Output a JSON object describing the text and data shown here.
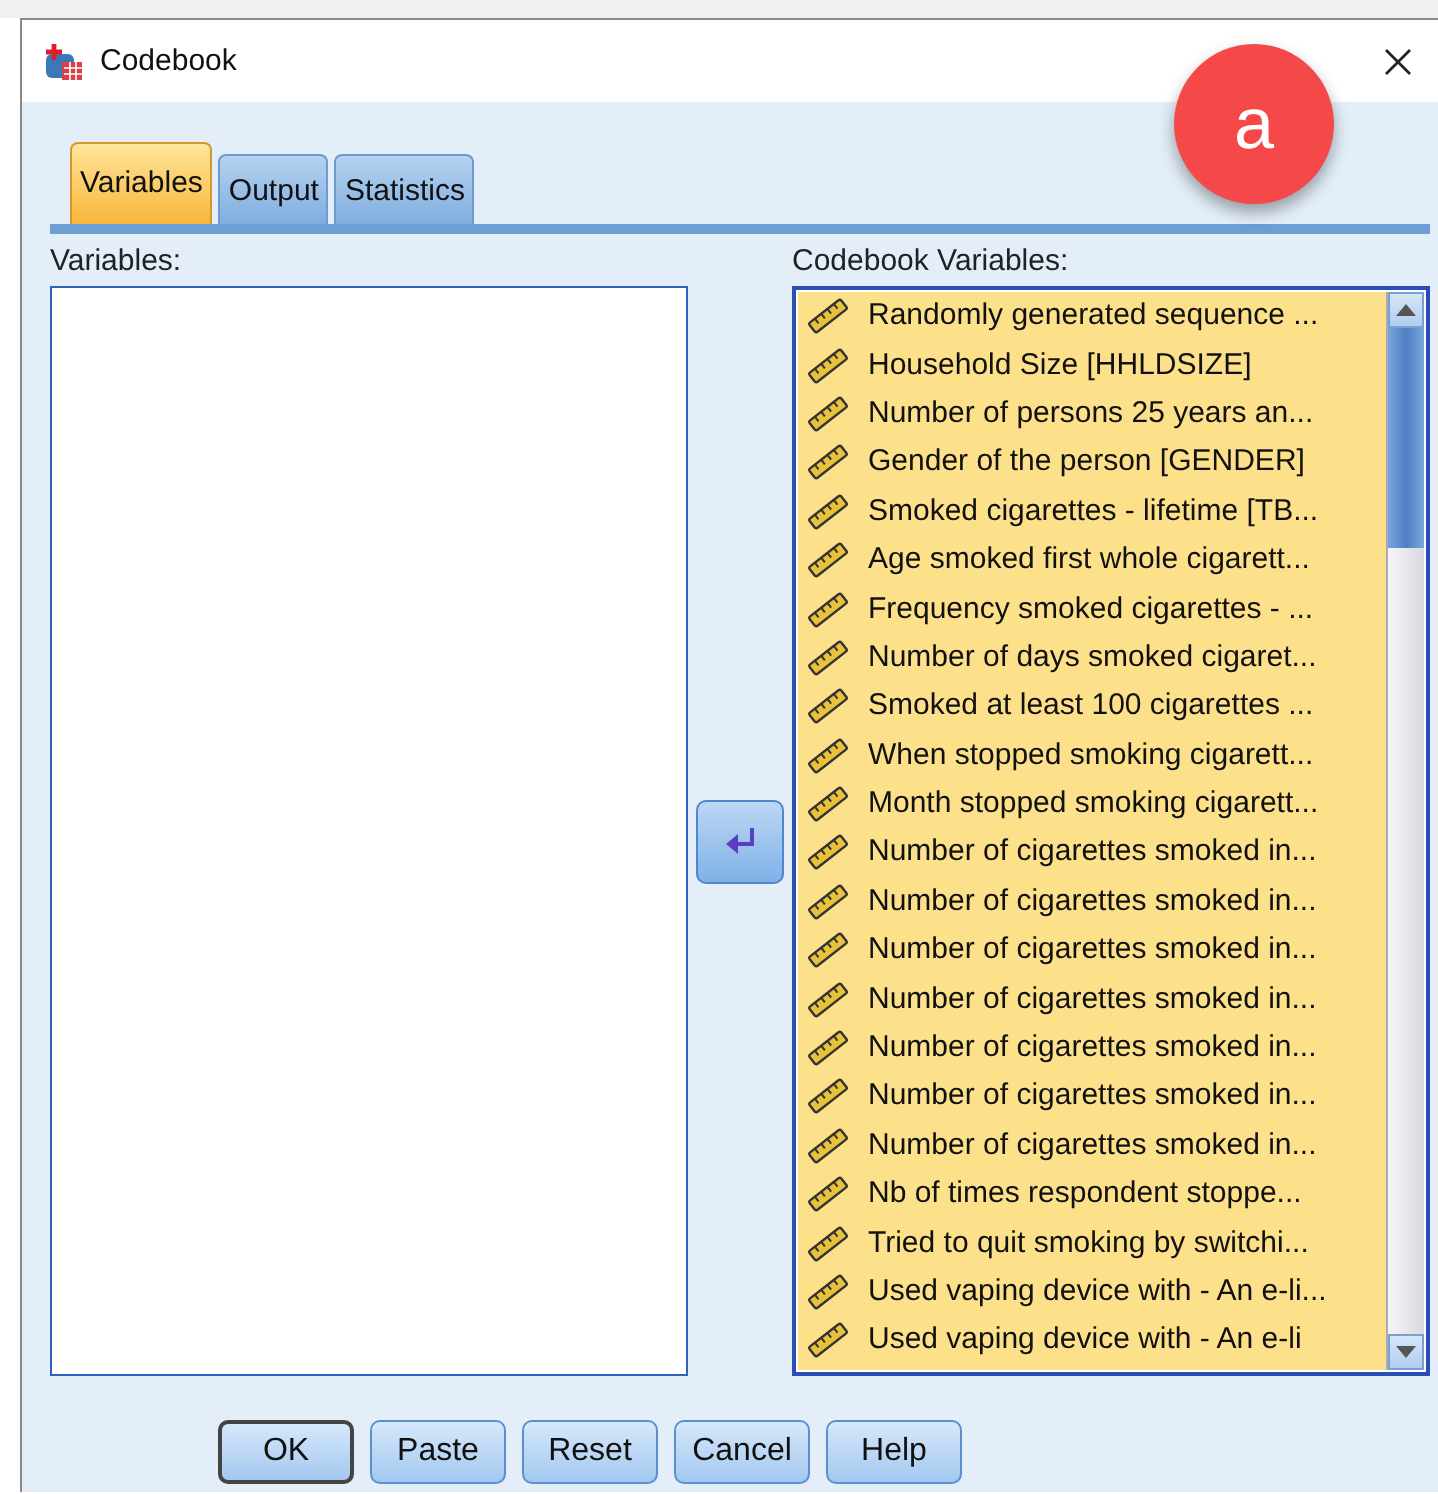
{
  "window": {
    "title": "Codebook"
  },
  "badge": "a",
  "tabs": [
    {
      "label": "Variables",
      "selected": true
    },
    {
      "label": "Output",
      "selected": false
    },
    {
      "label": "Statistics",
      "selected": false
    }
  ],
  "variables": {
    "label": "Variables:"
  },
  "codebook_variables": {
    "label": "Codebook Variables:",
    "items": [
      "Randomly generated sequence ...",
      "Household Size [HHLDSIZE]",
      "Number of persons 25 years an...",
      "Gender of the person [GENDER]",
      "Smoked cigarettes - lifetime [TB...",
      "Age smoked first whole cigarett...",
      "Frequency smoked cigarettes - ...",
      "Number of days smoked cigaret...",
      "Smoked at least 100 cigarettes ...",
      "When stopped smoking cigarett...",
      "Month stopped smoking cigarett...",
      "Number of cigarettes smoked in...",
      "Number of cigarettes smoked in...",
      "Number of cigarettes smoked in...",
      "Number of cigarettes smoked in...",
      "Number of cigarettes smoked in...",
      "Number of cigarettes smoked in...",
      "Number of cigarettes smoked in...",
      "Nb of times respondent stoppe...",
      "Tried to quit smoking by switchi...",
      "Used vaping device with - An e-li...",
      "Used vaping device with - An e-li"
    ]
  },
  "buttons": [
    {
      "label": "OK",
      "default": true
    },
    {
      "label": "Paste",
      "default": false
    },
    {
      "label": "Reset",
      "default": false
    },
    {
      "label": "Cancel",
      "default": false
    },
    {
      "label": "Help",
      "default": false
    }
  ]
}
